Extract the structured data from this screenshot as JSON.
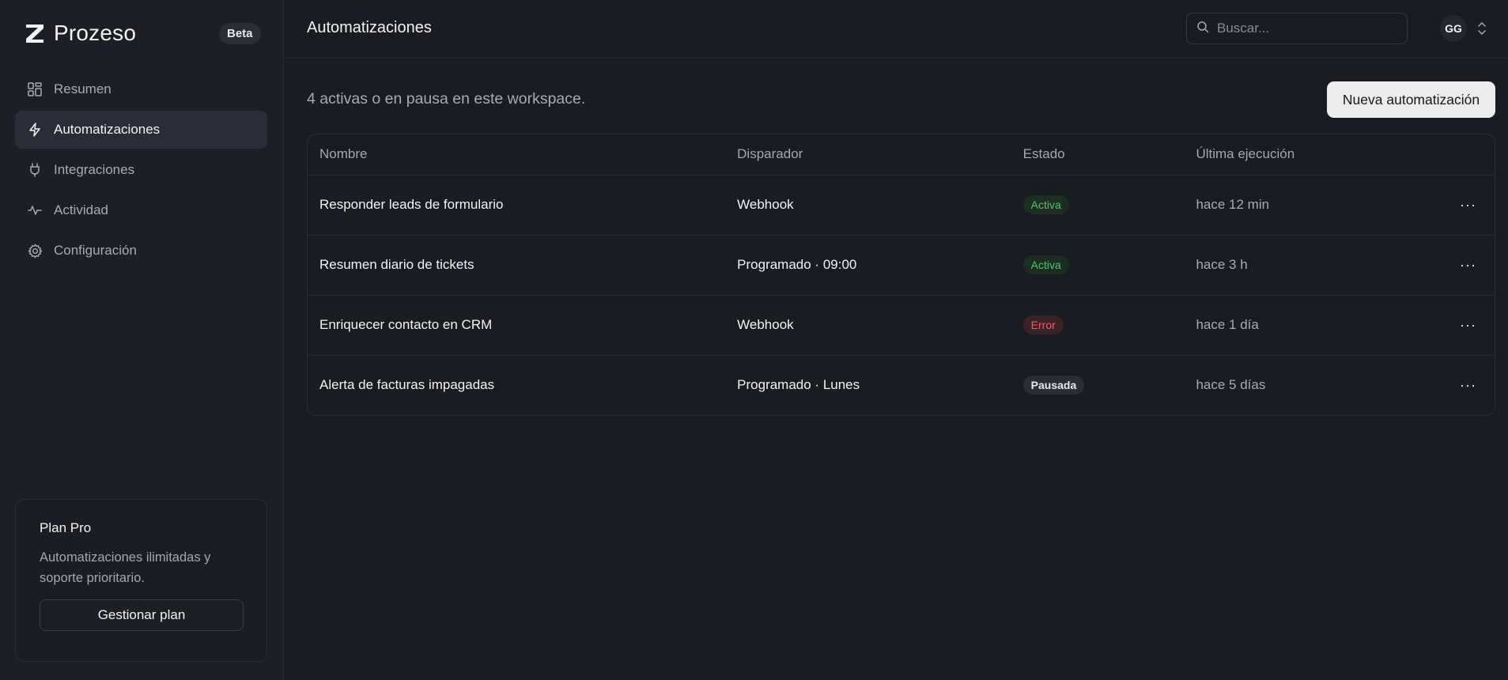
{
  "brand": {
    "name": "Prozeso",
    "badge": "Beta"
  },
  "sidebar": {
    "items": [
      {
        "label": "Resumen",
        "icon": "grid-icon"
      },
      {
        "label": "Automatizaciones",
        "icon": "bolt-icon",
        "active": true
      },
      {
        "label": "Integraciones",
        "icon": "plug-icon"
      },
      {
        "label": "Actividad",
        "icon": "activity-icon"
      },
      {
        "label": "Configuración",
        "icon": "gear-icon"
      }
    ]
  },
  "plan": {
    "title": "Plan Pro",
    "description": "Automatizaciones ilimitadas y soporte prioritario.",
    "button": "Gestionar plan"
  },
  "header": {
    "title": "Automatizaciones",
    "search_placeholder": "Buscar...",
    "avatar_initials": "GG"
  },
  "main": {
    "summary": "4 activas o en pausa en este workspace.",
    "new_button": "Nueva automatización",
    "table": {
      "columns": [
        "Nombre",
        "Disparador",
        "Estado",
        "Última ejecución"
      ],
      "rows": [
        {
          "name": "Responder leads de formulario",
          "trigger": "Webhook",
          "status": "Activa",
          "last_run": "hace 12 min"
        },
        {
          "name": "Resumen diario de tickets",
          "trigger": "Programado · 09:00",
          "status": "Activa",
          "last_run": "hace 3 h"
        },
        {
          "name": "Enriquecer contacto en CRM",
          "trigger": "Webhook",
          "status": "Error",
          "last_run": "hace 1 día"
        },
        {
          "name": "Alerta de facturas impagadas",
          "trigger": "Programado · Lunes",
          "status": "Pausada",
          "last_run": "hace 5 días"
        }
      ],
      "row_menu": "···"
    }
  },
  "colors": {
    "background": "#1a1c21",
    "sidebar": "#1d1f24",
    "status_active": "#4ec66a",
    "status_error": "#ef5b63",
    "primary_button": "#ececec"
  }
}
